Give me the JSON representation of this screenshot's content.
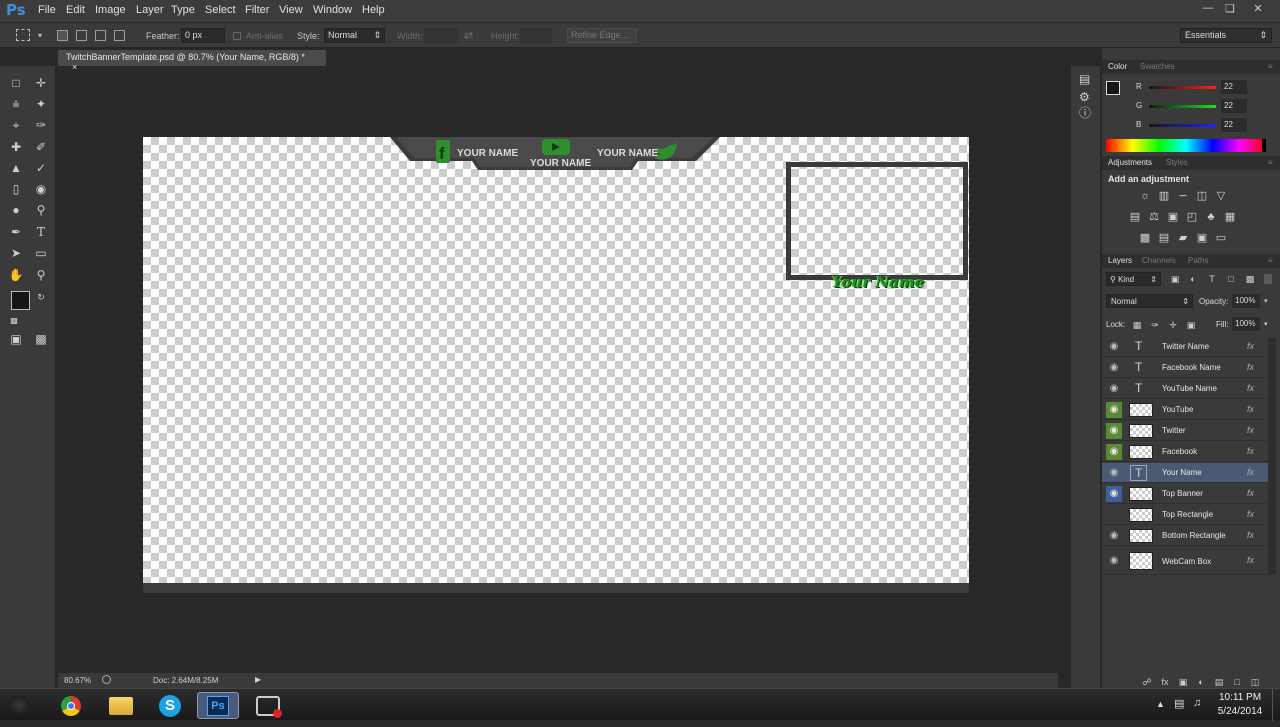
{
  "app": {
    "logo": "Ps"
  },
  "menu": [
    "File",
    "Edit",
    "Image",
    "Layer",
    "Type",
    "Select",
    "Filter",
    "View",
    "Window",
    "Help"
  ],
  "options_bar": {
    "feather_label": "Feather:",
    "feather_value": "0 px",
    "antialias_label": "Anti-alias",
    "style_label": "Style:",
    "style_value": "Normal",
    "width_label": "Width:",
    "height_label": "Height:",
    "refine_edge": "Refine Edge...",
    "workspace": "Essentials"
  },
  "document": {
    "tab_title": "TwitchBannerTemplate.psd @ 80.7% (Your Name, RGB/8) *",
    "zoom": "80.67%",
    "doc_info": "Doc: 2.64M/8.25M"
  },
  "canvas": {
    "social_labels": [
      "YOUR NAME",
      "YOUR NAME",
      "YOUR NAME"
    ],
    "your_name": "Your Name",
    "colors": {
      "green": "#2e8f2e",
      "banner": "#3a3a3a"
    }
  },
  "color_panel": {
    "tabs": [
      "Color",
      "Swatches"
    ],
    "channels": [
      {
        "label": "R",
        "value": "22"
      },
      {
        "label": "G",
        "value": "22"
      },
      {
        "label": "B",
        "value": "22"
      }
    ]
  },
  "adjustments_panel": {
    "tabs": [
      "Adjustments",
      "Styles"
    ],
    "heading": "Add an adjustment"
  },
  "layers_panel": {
    "tabs": [
      "Layers",
      "Channels",
      "Paths"
    ],
    "kind": "Kind",
    "blend_mode": "Normal",
    "opacity_label": "Opacity:",
    "opacity_value": "100%",
    "lock_label": "Lock:",
    "fill_label": "Fill:",
    "fill_value": "100%",
    "layers": [
      {
        "name": "Twitter Name",
        "type": "text",
        "eye": "normal"
      },
      {
        "name": "Facebook Name",
        "type": "text",
        "eye": "normal"
      },
      {
        "name": "YouTube Name",
        "type": "text",
        "eye": "normal"
      },
      {
        "name": "YouTube",
        "type": "image",
        "eye": "green"
      },
      {
        "name": "Twitter",
        "type": "image",
        "eye": "green"
      },
      {
        "name": "Facebook",
        "type": "image",
        "eye": "green"
      },
      {
        "name": "Your Name",
        "type": "text",
        "eye": "normal",
        "selected": true
      },
      {
        "name": "Top Banner",
        "type": "image",
        "eye": "blue"
      },
      {
        "name": "Top Rectangle",
        "type": "image",
        "eye": "hidden"
      },
      {
        "name": "Bottom Rectangle",
        "type": "image",
        "eye": "normal"
      },
      {
        "name": "WebCam Box",
        "type": "image",
        "eye": "normal"
      }
    ],
    "fx": "fx"
  },
  "taskbar": {
    "time": "10:11 PM",
    "date": "5/24/2014"
  }
}
